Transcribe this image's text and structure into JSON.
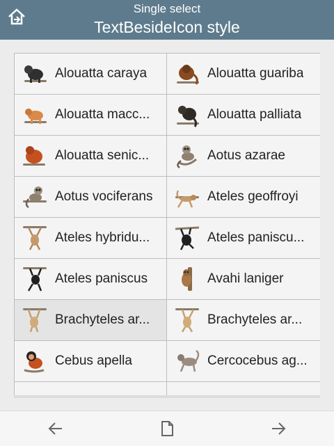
{
  "header": {
    "subtitle": "Single select",
    "title": "TextBesideIcon style",
    "home_icon": "home-icon",
    "color": "#5d7b8c"
  },
  "items": [
    {
      "label": "Alouatta caraya",
      "icon": "howler-monkey-black-icon"
    },
    {
      "label": "Alouatta guariba",
      "icon": "howler-monkey-brown-icon"
    },
    {
      "label": "Alouatta macc...",
      "icon": "howler-monkey-tan-icon"
    },
    {
      "label": "Alouatta palliata",
      "icon": "howler-monkey-dark-icon"
    },
    {
      "label": "Alouatta senic...",
      "icon": "howler-monkey-red-icon"
    },
    {
      "label": "Aotus azarae",
      "icon": "night-monkey-icon"
    },
    {
      "label": "Aotus vociferans",
      "icon": "night-monkey-icon"
    },
    {
      "label": "Ateles geoffroyi",
      "icon": "spider-monkey-tan-icon"
    },
    {
      "label": "Ateles hybridu...",
      "icon": "spider-monkey-hanging-icon"
    },
    {
      "label": "Ateles paniscu...",
      "icon": "spider-monkey-black-icon"
    },
    {
      "label": "Ateles paniscus",
      "icon": "spider-monkey-black-hanging-icon"
    },
    {
      "label": "Avahi laniger",
      "icon": "woolly-lemur-icon"
    },
    {
      "label": "Brachyteles ar...",
      "icon": "muriqui-hanging-icon"
    },
    {
      "label": "Brachyteles ar...",
      "icon": "muriqui-hanging-icon"
    },
    {
      "label": "Cebus apella",
      "icon": "capuchin-icon"
    },
    {
      "label": "Cercocebus ag...",
      "icon": "mangabey-icon"
    }
  ],
  "selected_index": 12,
  "bottom_bar": {
    "back_icon": "arrow-left-icon",
    "page_icon": "document-icon",
    "forward_icon": "arrow-right-icon"
  }
}
